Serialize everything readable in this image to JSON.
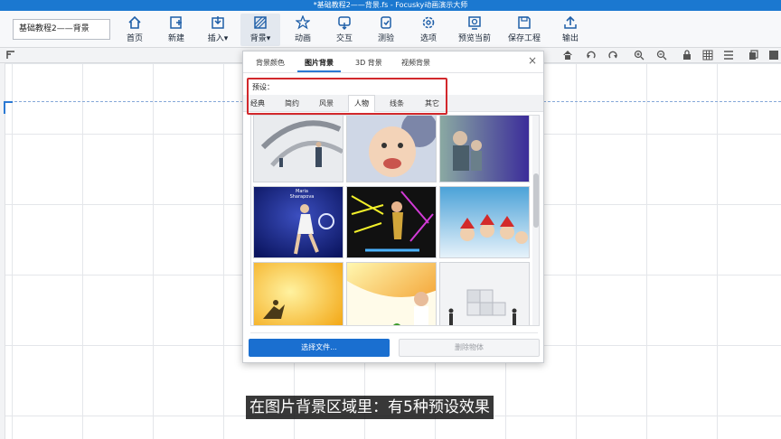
{
  "window": {
    "title": "*基础教程2——背景.fs - Focusky动画演示大师"
  },
  "project": {
    "name": "基础教程2——背景"
  },
  "toolbar": {
    "items": [
      {
        "label": "首页",
        "icon": "home-icon"
      },
      {
        "label": "新建",
        "icon": "new-icon"
      },
      {
        "label": "插入▾",
        "icon": "insert-icon"
      },
      {
        "label": "背景▾",
        "icon": "background-icon"
      },
      {
        "label": "动画",
        "icon": "animation-icon"
      },
      {
        "label": "交互",
        "icon": "interaction-icon"
      },
      {
        "label": "测验",
        "icon": "quiz-icon"
      },
      {
        "label": "选项",
        "icon": "settings-icon"
      },
      {
        "label": "预览当前",
        "icon": "preview-icon"
      },
      {
        "label": "保存工程",
        "icon": "save-icon"
      },
      {
        "label": "输出",
        "icon": "export-icon"
      }
    ]
  },
  "dialog": {
    "tabs": [
      "背景颜色",
      "图片背景",
      "3D 背景",
      "视频背景"
    ],
    "active_tab": "图片背景",
    "close": "×",
    "preset_label": "预设：",
    "preset_tabs": [
      "经典",
      "简约",
      "风景",
      "人物",
      "线条",
      "其它"
    ],
    "active_preset": "人物",
    "thumbnails": [
      {
        "name": "businessman-arrows",
        "caption": ""
      },
      {
        "name": "laughing-baby",
        "caption": ""
      },
      {
        "name": "family-purple",
        "caption": ""
      },
      {
        "name": "tennis-player",
        "caption": "Maria Sharapova"
      },
      {
        "name": "neon-dancer",
        "caption": ""
      },
      {
        "name": "christmas-kids",
        "caption": ""
      },
      {
        "name": "yellow-silhouette",
        "caption": ""
      },
      {
        "name": "chef-vegetables",
        "caption": ""
      },
      {
        "name": "puzzle-team",
        "caption": ""
      }
    ],
    "select_file_label": "选择文件...",
    "delete_label": "删除物体"
  },
  "caption": "在图片背景区域里：有5种预设效果",
  "colors": {
    "title_bar": "#1b78d0",
    "accent": "#2b79d3",
    "highlight_box": "#d2282c",
    "primary_button": "#1a6fd0"
  }
}
